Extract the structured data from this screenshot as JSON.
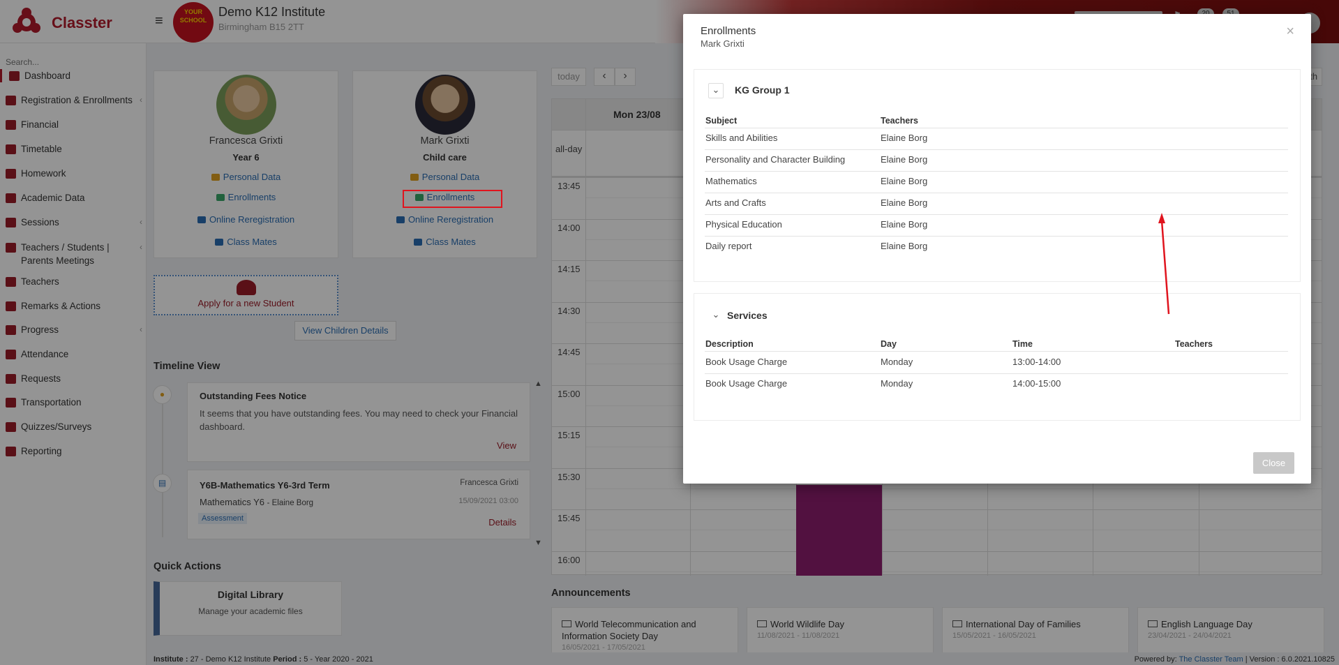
{
  "header": {
    "brand": "Classter",
    "school_logo_text": "YOUR SCHOOL",
    "institute_name": "Demo K12 Institute",
    "institute_address": "Birmingham B15 2TT",
    "badge1": "20",
    "badge2": "51"
  },
  "sidebar": {
    "search_placeholder": "Search...",
    "items": [
      {
        "label": "Dashboard",
        "chevron": ""
      },
      {
        "label": "Registration & Enrollments",
        "chevron": "‹"
      },
      {
        "label": "Financial",
        "chevron": ""
      },
      {
        "label": "Timetable",
        "chevron": ""
      },
      {
        "label": "Homework",
        "chevron": ""
      },
      {
        "label": "Academic Data",
        "chevron": ""
      },
      {
        "label": "Sessions",
        "chevron": "‹"
      },
      {
        "label": "Teachers / Students | Parents Meetings",
        "chevron": "‹"
      },
      {
        "label": "Teachers",
        "chevron": ""
      },
      {
        "label": "Remarks & Actions",
        "chevron": ""
      },
      {
        "label": "Progress",
        "chevron": "‹"
      },
      {
        "label": "Attendance",
        "chevron": ""
      },
      {
        "label": "Requests",
        "chevron": ""
      },
      {
        "label": "Transportation",
        "chevron": ""
      },
      {
        "label": "Quizzes/Surveys",
        "chevron": ""
      },
      {
        "label": "Reporting",
        "chevron": ""
      }
    ]
  },
  "students": [
    {
      "name": "Francesca Grixti",
      "year": "Year 6",
      "personal": "Personal Data",
      "enrollments": "Enrollments",
      "rereg": "Online Reregistration",
      "classmates": "Class Mates"
    },
    {
      "name": "Mark Grixti",
      "year": "Child care",
      "personal": "Personal Data",
      "enrollments": "Enrollments",
      "rereg": "Online Reregistration",
      "classmates": "Class Mates"
    }
  ],
  "apply_label": "Apply for a new Student",
  "view_children": "View Children Details",
  "timeline": {
    "title": "Timeline View",
    "item1": {
      "title": "Outstanding Fees Notice",
      "body": "It seems that you have outstanding fees. You may need to check your Financial dashboard.",
      "action": "View"
    },
    "item2": {
      "title": "Y6B-Mathematics Y6-3rd Term",
      "student": "Francesca Grixti",
      "subject": "Mathematics Y6",
      "teacher": "- Elaine Borg",
      "date": "15/09/2021 03:00",
      "tag": "Assessment",
      "action": "Details"
    }
  },
  "quick": {
    "title": "Quick Actions",
    "lib_title": "Digital Library",
    "lib_sub": "Manage your academic files"
  },
  "calendar": {
    "today": "today",
    "prev": "‹",
    "next": "›",
    "month": "month",
    "day_header": "Mon 23/08",
    "allday": "all-day",
    "times": [
      "13:45",
      "14:00",
      "14:15",
      "14:30",
      "14:45",
      "15:00",
      "15:15",
      "15:30",
      "15:45",
      "16:00"
    ]
  },
  "announcements": {
    "title": "Announcements",
    "items": [
      {
        "title": "World Telecommunication and Information Society Day",
        "date": "16/05/2021 - 17/05/2021"
      },
      {
        "title": "World Wildlife Day",
        "date": "11/08/2021 - 11/08/2021"
      },
      {
        "title": "International Day of Families",
        "date": "15/05/2021 - 16/05/2021"
      },
      {
        "title": "English Language Day",
        "date": "23/04/2021 - 24/04/2021"
      }
    ]
  },
  "footer": {
    "institute_label": "Institute :",
    "institute_val": "27 - Demo K12 Institute",
    "period_label": "Period :",
    "period_val": "5 - Year 2020 - 2021",
    "powered": "Powered by:",
    "team": "The Classter Team",
    "version": "| Version : 6.0.2021.10825"
  },
  "modal": {
    "title": "Enrollments",
    "subtitle": "Mark Grixti",
    "close_x": "×",
    "close_btn": "Close",
    "group": {
      "title": "KG Group 1",
      "col_subject": "Subject",
      "col_teachers": "Teachers",
      "rows": [
        {
          "subject": "Skills and Abilities",
          "teacher": "Elaine Borg"
        },
        {
          "subject": "Personality and Character Building",
          "teacher": "Elaine Borg"
        },
        {
          "subject": "Mathematics",
          "teacher": "Elaine Borg"
        },
        {
          "subject": "Arts and Crafts",
          "teacher": "Elaine Borg"
        },
        {
          "subject": "Physical Education",
          "teacher": "Elaine Borg"
        },
        {
          "subject": "Daily report",
          "teacher": "Elaine Borg"
        }
      ]
    },
    "services": {
      "title": "Services",
      "col_desc": "Description",
      "col_day": "Day",
      "col_time": "Time",
      "col_teachers": "Teachers",
      "rows": [
        {
          "desc": "Book Usage Charge",
          "day": "Monday",
          "time": "13:00-14:00",
          "teachers": ""
        },
        {
          "desc": "Book Usage Charge",
          "day": "Monday",
          "time": "14:00-15:00",
          "teachers": ""
        }
      ]
    }
  },
  "colors": {
    "brand": "#b11b2b",
    "link": "#2a6db3",
    "event": "#8e1e6e",
    "highlight_box": "#e0141e",
    "annotation_arrow": "#e0141e"
  }
}
